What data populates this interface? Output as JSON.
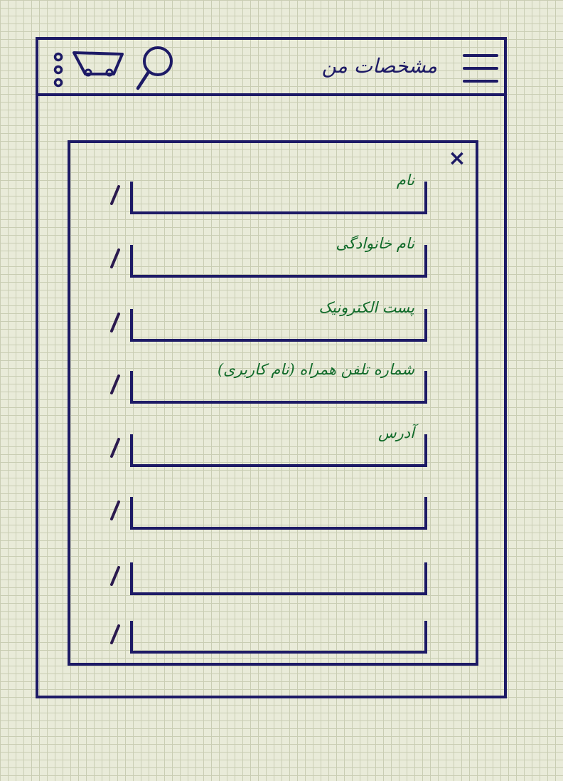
{
  "header": {
    "title": "مشخصات من",
    "icons": [
      "menu-icon",
      "search-icon",
      "cart-icon",
      "more-vertical-icon"
    ]
  },
  "dialog": {
    "close_label": "×",
    "fields": [
      {
        "label": "نام",
        "value": ""
      },
      {
        "label": "نام خانوادگی",
        "value": ""
      },
      {
        "label": "پست الکترونیک",
        "value": ""
      },
      {
        "label": "شماره تلفن همراه (نام کاربری)",
        "value": ""
      },
      {
        "label": "آدرس",
        "value": ""
      },
      {
        "label": "",
        "value": ""
      },
      {
        "label": "",
        "value": ""
      },
      {
        "label": "",
        "value": ""
      }
    ],
    "edit_icon": "edit-pencil-icon"
  },
  "colors": {
    "ink": "#1d1a66",
    "label_ink": "#116b2a",
    "paper": "#e9ebd9",
    "grid": "#c9cdb3"
  }
}
